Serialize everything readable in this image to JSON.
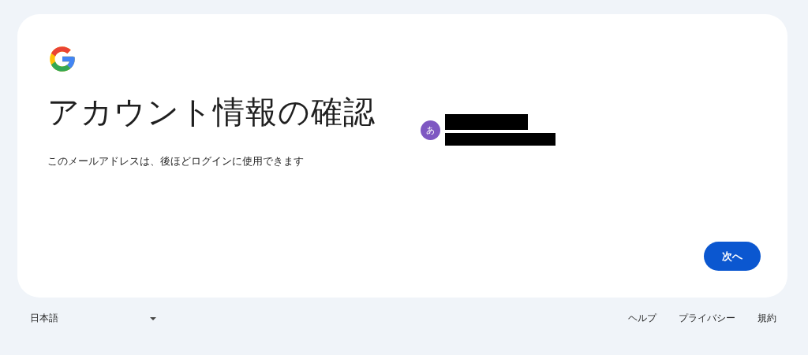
{
  "card": {
    "title": "アカウント情報の確認",
    "subtitle": "このメールアドレスは、後ほどログインに使用できます",
    "account": {
      "avatar_letter": "あ"
    },
    "next_button": "次へ"
  },
  "footer": {
    "language": "日本語",
    "links": [
      "ヘルプ",
      "プライバシー",
      "規約"
    ]
  }
}
